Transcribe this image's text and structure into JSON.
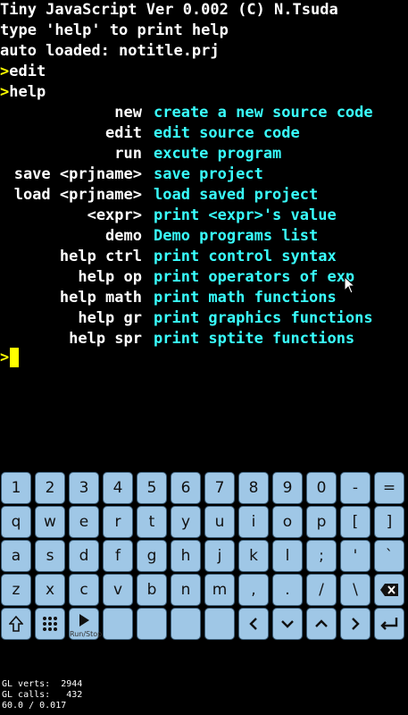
{
  "terminal": {
    "banner": [
      "Tiny JavaScript Ver 0.002 (C) N.Tsuda",
      "type 'help' to print help",
      "auto loaded: notitle.prj"
    ],
    "history": [
      {
        "prompt": ">",
        "command": "edit"
      },
      {
        "prompt": ">",
        "command": "help"
      }
    ],
    "help_rows": [
      {
        "cmd": "new",
        "desc": "create a new source code"
      },
      {
        "cmd": "edit",
        "desc": "edit source code"
      },
      {
        "cmd": "run",
        "desc": "excute program"
      },
      {
        "cmd": "save <prjname>",
        "desc": "save project"
      },
      {
        "cmd": "load <prjname>",
        "desc": "load saved project"
      },
      {
        "cmd": "<expr>",
        "desc": "print <expr>'s value"
      },
      {
        "cmd": "demo",
        "desc": "Demo programs list"
      },
      {
        "cmd": "help ctrl",
        "desc": "print control syntax"
      },
      {
        "cmd": "help op",
        "desc": "print operators of exp"
      },
      {
        "cmd": "help math",
        "desc": "print math functions"
      },
      {
        "cmd": "help gr",
        "desc": "print graphics functions"
      },
      {
        "cmd": "help spr",
        "desc": "print sptite functions"
      }
    ],
    "current_prompt": ">"
  },
  "keyboard": {
    "rows": [
      [
        "1",
        "2",
        "3",
        "4",
        "5",
        "6",
        "7",
        "8",
        "9",
        "0",
        "-",
        "="
      ],
      [
        "q",
        "w",
        "e",
        "r",
        "t",
        "y",
        "u",
        "i",
        "o",
        "p",
        "[",
        "]"
      ],
      [
        "a",
        "s",
        "d",
        "f",
        "g",
        "h",
        "j",
        "k",
        "l",
        ";",
        "'",
        "`"
      ],
      [
        "z",
        "x",
        "c",
        "v",
        "b",
        "n",
        "m",
        ",",
        ".",
        "/",
        "\\",
        "backspace-icon"
      ],
      [
        "shift-icon",
        "grid-icon",
        "run-icon",
        "",
        "",
        "",
        "",
        "chevron-left-icon",
        "chevron-down-icon",
        "chevron-up-icon",
        "chevron-right-icon",
        "enter-icon"
      ]
    ],
    "run_stop_label": "Run/Stop"
  },
  "stats": {
    "verts": "GL verts:  2944",
    "calls": "GL calls:   432",
    "fps": "60.0 / 0.017"
  },
  "colors": {
    "prompt": "#ffff00",
    "help_desc": "#39ffff",
    "key_fill": "#9fc7e6"
  }
}
